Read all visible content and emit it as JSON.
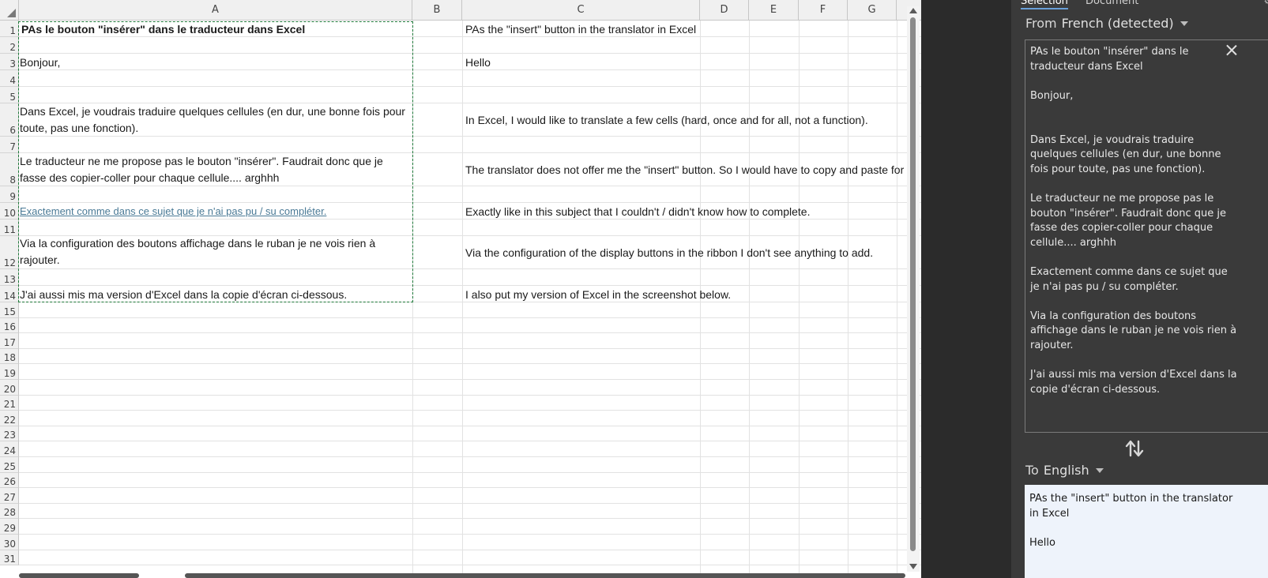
{
  "sheet": {
    "columns": [
      "A",
      "B",
      "C",
      "D",
      "E",
      "F",
      "G"
    ],
    "rows": [
      "1",
      "2",
      "3",
      "4",
      "5",
      "6",
      "7",
      "8",
      "9",
      "10",
      "11",
      "12",
      "13",
      "14",
      "15",
      "16",
      "17",
      "18",
      "19",
      "20",
      "21",
      "22",
      "23",
      "24",
      "25",
      "26",
      "27",
      "28",
      "29",
      "30",
      "31"
    ],
    "cells": {
      "A1": "PAs le bouton \"insérer\" dans le traducteur dans Excel",
      "A3": "Bonjour,",
      "A6": "Dans Excel, je voudrais traduire quelques cellules (en dur, une bonne fois pour toute, pas une fonction).",
      "A8": "Le traducteur ne me propose pas le bouton \"insérer\". Faudrait donc que je fasse des copier-coller pour chaque cellule.... arghhh",
      "A10": "Exactement comme dans ce sujet que je n'ai pas pu / su compléter.",
      "A12": "Via la configuration des boutons affichage dans le ruban je ne vois rien à rajouter.",
      "A14": "J'ai aussi mis ma version d'Excel dans la copie d'écran ci-dessous.",
      "C1": "PAs the \"insert\" button in the translator in Excel",
      "C3": "Hello",
      "C6": "In Excel, I would like to translate a few cells (hard, once and for all, not a function).",
      "C8": "The translator does not offer me the \"insert\" button. So I would have to copy and paste for each cell.... arghhh",
      "C10": "Exactly like in this subject that I couldn't / didn't know how to complete.",
      "C12": "Via the configuration of the display buttons in the ribbon I don't see anything to add.",
      "C14": "I also put my version of Excel in the screenshot below."
    }
  },
  "translator": {
    "tabs": [
      {
        "label": "Selection",
        "active": true
      },
      {
        "label": "Document",
        "active": false
      }
    ],
    "from_label": "From",
    "from_value": "French (detected)",
    "to_label": "To",
    "to_value": "English",
    "source_text": "PAs le bouton \"insérer\" dans le traducteur dans Excel\n\nBonjour,\n\n\nDans Excel, je voudrais traduire quelques cellules (en dur, une bonne fois pour toute, pas une fonction).\n\nLe traducteur ne me propose pas le bouton \"insérer\". Faudrait donc que je fasse des copier-coller pour chaque cellule.... arghhh\n\nExactement comme dans ce sujet que je n'ai pas pu / su compléter.\n\nVia la configuration des boutons affichage dans le ruban je ne vois rien à rajouter.\n\nJ'ai aussi mis ma version d'Excel dans la copie d'écran ci-dessous.",
    "target_text": "PAs the \"insert\" button in the translator in Excel\n\nHello"
  },
  "colors": {
    "selection_border": "#1f7a3a",
    "link": "#4a7a96",
    "pane_bg": "#3a3a3a",
    "target_bg": "#eef3fb"
  }
}
